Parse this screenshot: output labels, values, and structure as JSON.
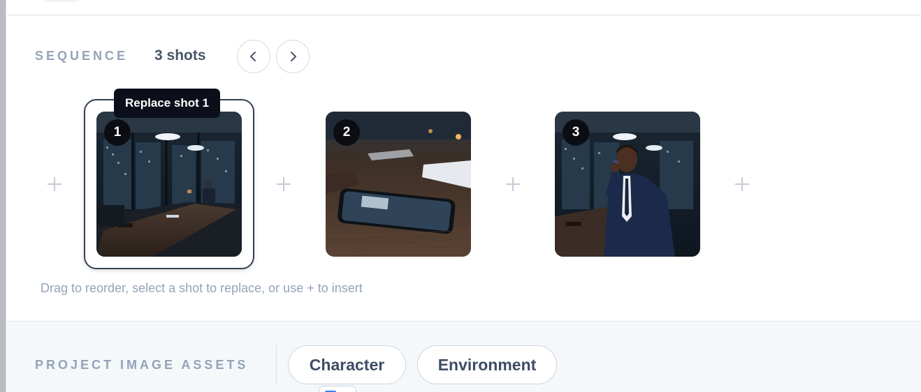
{
  "sequence": {
    "label": "SEQUENCE",
    "shot_count": "3 shots",
    "hint": "Drag to reorder, select a shot to replace, or use + to insert",
    "tooltip": "Replace shot 1",
    "shots": [
      {
        "number": "1",
        "scene": "conference-room-wide",
        "selected": true
      },
      {
        "number": "2",
        "scene": "phone-on-table-closeup",
        "selected": false
      },
      {
        "number": "3",
        "scene": "man-on-phone-in-office",
        "selected": false
      }
    ]
  },
  "assets": {
    "label": "PROJECT IMAGE ASSETS",
    "tabs": [
      "Character",
      "Environment"
    ]
  },
  "icons": {
    "prev": "chevron-left-icon",
    "next": "chevron-right-icon",
    "insert": "plus-icon"
  },
  "colors": {
    "section_label": "#94a3b8",
    "tooltip_bg": "#0b0f1a",
    "badge_bg": "#0b0d12",
    "selected_ring": "#334155",
    "assets_bg": "#f5f8fa"
  }
}
